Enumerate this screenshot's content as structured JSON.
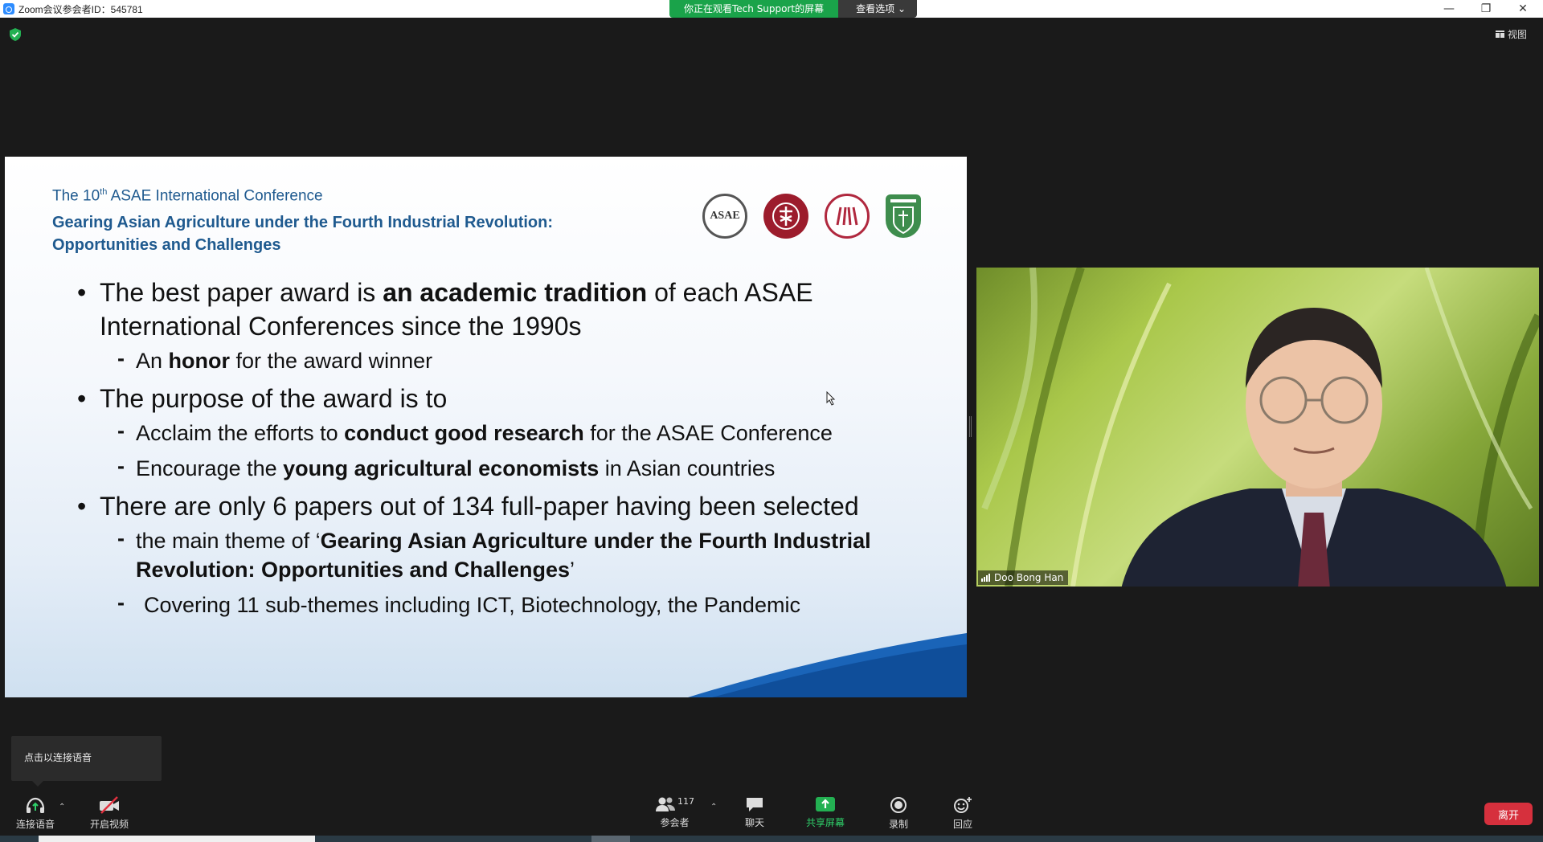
{
  "window": {
    "title": "Zoom会议参会者ID：545781",
    "minimize_glyph": "—",
    "restore_glyph": "❐",
    "close_glyph": "✕"
  },
  "screen_share": {
    "message": "你正在观看Tech Support的屏幕",
    "options_label": "查看选项 ⌄"
  },
  "view_button": {
    "label": "视图"
  },
  "slide": {
    "conference_prefix": "The 10",
    "conference_sup": "th",
    "conference_suffix": " ASAE International Conference",
    "subtitle_line1": "Gearing Asian Agriculture under the Fourth Industrial Revolution:",
    "subtitle_line2": "Opportunities and Challenges",
    "logo_asae_text": "ASAE",
    "bullet1": {
      "a": "The best paper award is ",
      "b": "an academic tradition",
      "c": " of each ASAE International Conferences since the 1990s"
    },
    "bullet1_sub1": {
      "a": "An ",
      "b": "honor",
      "c": " for the award winner"
    },
    "bullet2": "The purpose of the award is to",
    "bullet2_sub1": {
      "a": "Acclaim the efforts to ",
      "b": "conduct good research",
      "c": " for the ASAE Conference"
    },
    "bullet2_sub2": {
      "a": "Encourage the ",
      "b": "young agricultural economists",
      "c": " in Asian countries"
    },
    "bullet3": "There are only 6 papers out of 134 full-paper having been selected",
    "bullet3_sub1": {
      "a": "the main theme of ‘",
      "b": "Gearing Asian Agriculture under the Fourth Industrial Revolution: Opportunities and Challenges",
      "c": "’"
    },
    "bullet3_sub2": "Covering 11 sub-themes including ICT, Biotechnology, the Pandemic"
  },
  "video": {
    "participant_name": "Doo Bong Han"
  },
  "audio_tip": {
    "text": "点击以连接语音"
  },
  "toolbar": {
    "audio_label": "连接语音",
    "video_label": "开启视频",
    "participants_label": "参会者",
    "participants_count": "117",
    "chat_label": "聊天",
    "share_label": "共享屏幕",
    "record_label": "录制",
    "reactions_label": "回应",
    "caret": "⌃"
  },
  "leave_button": {
    "label": "离开"
  },
  "colors": {
    "share_green": "#1aa34a",
    "leave_red": "#d6303d",
    "slide_blue": "#1f5a8f",
    "zoom_blue": "#2d8cff"
  },
  "icons": [
    "zoom-app-icon",
    "shield-check-icon",
    "view-grid-icon",
    "headphones-icon",
    "video-off-icon",
    "participants-icon",
    "chat-icon",
    "share-screen-icon",
    "record-icon",
    "reaction-icon",
    "signal-icon",
    "mouse-cursor-icon"
  ]
}
